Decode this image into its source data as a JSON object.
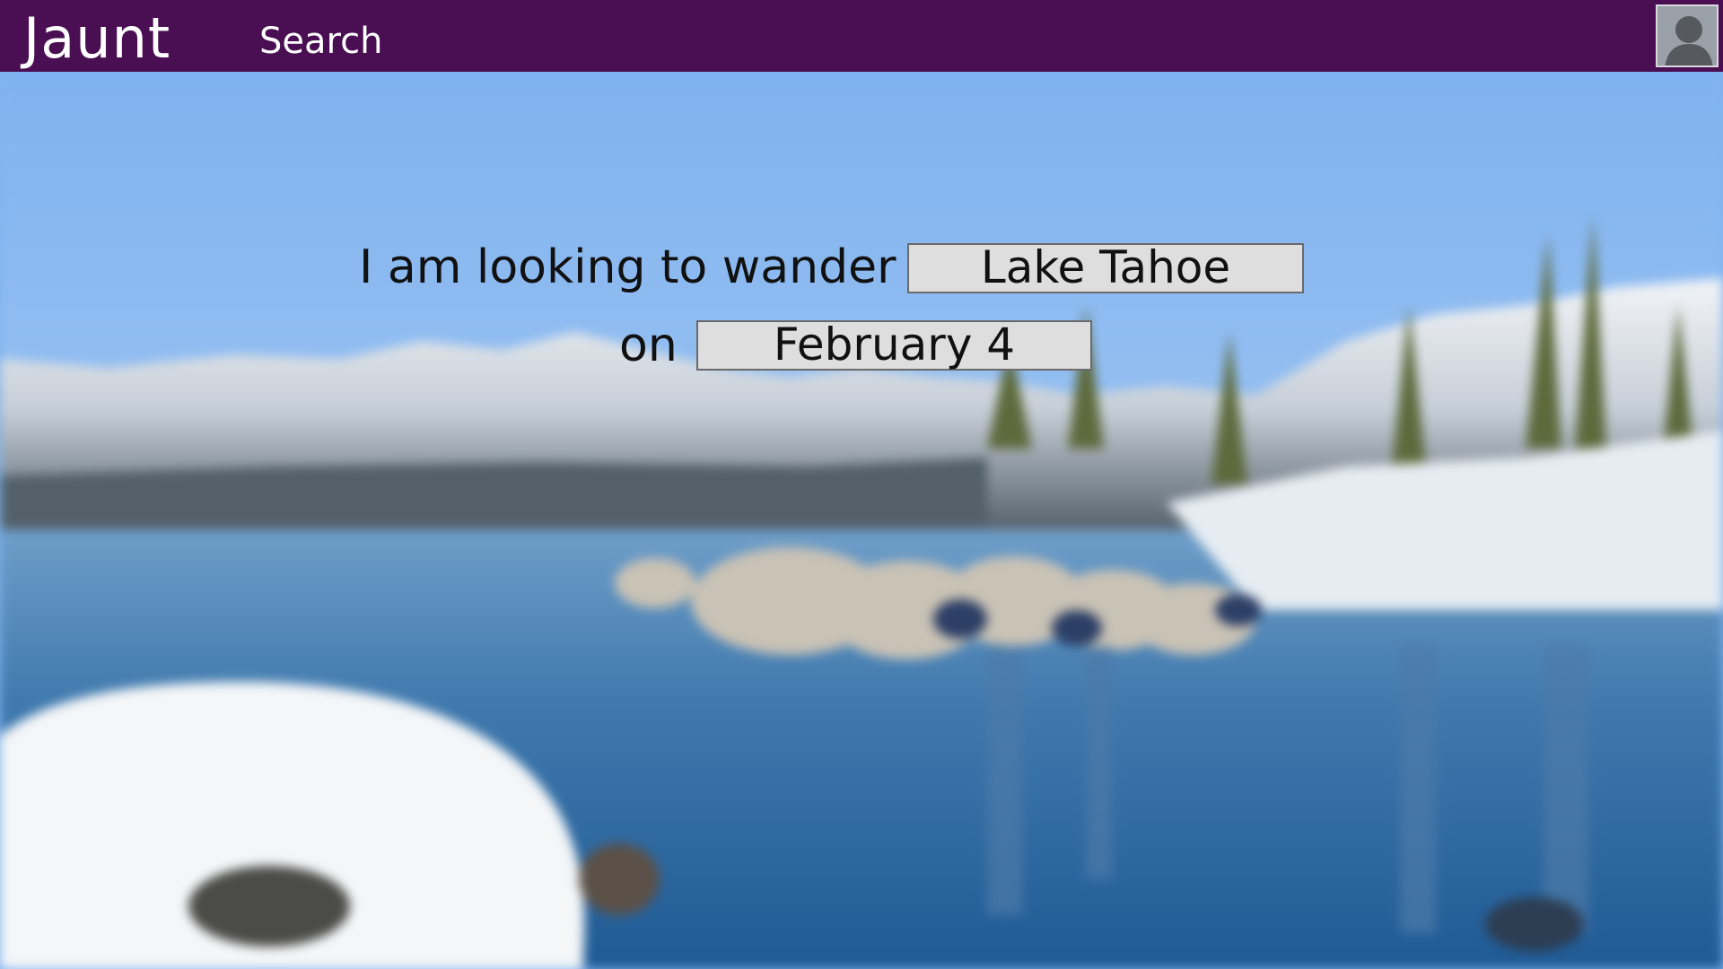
{
  "header": {
    "brand": "Jaunt",
    "nav_search": "Search",
    "avatar_icon": "user-avatar-icon",
    "background_color": "#4a0e52"
  },
  "hero": {
    "line1_text": "I am looking to wander",
    "destination_value": "Lake Tahoe",
    "line2_text": "on",
    "date_value": "February 4"
  }
}
